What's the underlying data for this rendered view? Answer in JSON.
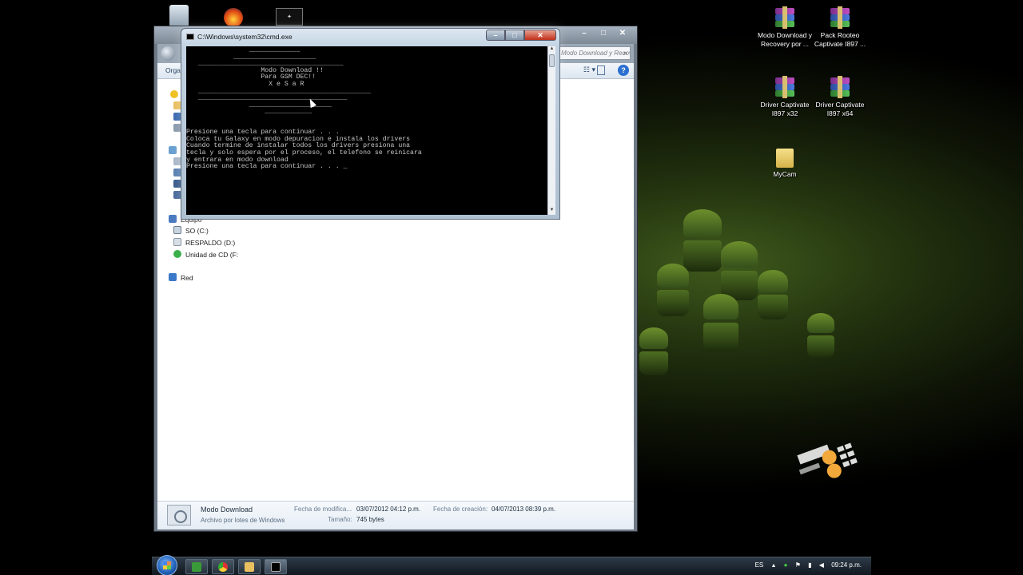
{
  "desktop": {
    "top_icons": [
      "recycle-bin-icon",
      "flame-app-icon",
      "synaptic-app-icon"
    ],
    "icons": [
      {
        "label": "Modo Download y Recovery por ...",
        "icon": "winrar-archive-icon"
      },
      {
        "label": "Pack Rooteo Captivate I897 ...",
        "icon": "winrar-archive-icon"
      },
      {
        "label": "Driver Captivate I897 x32",
        "icon": "winrar-archive-icon"
      },
      {
        "label": "Driver Captivate I897 x64",
        "icon": "winrar-archive-icon"
      },
      {
        "label": "MyCam",
        "icon": "folder-icon"
      }
    ],
    "wallpaper_color": "#3f5a1c"
  },
  "explorer": {
    "search_placeholder": "Modo Download y Recovery por ...",
    "organize_label": "Organizar",
    "nav": {
      "computer_label": "Equipo",
      "drives": [
        "SO (C:)",
        "RESPALDO (D:)",
        "Unidad de CD (F:"
      ],
      "network_label": "Red"
    },
    "details": {
      "name": "Modo Download",
      "type": "Archivo por lotes de Windows",
      "modified_label": "Fecha de modifica...",
      "modified_value": "03/07/2012 04:12 p.m.",
      "created_label": "Fecha de creación:",
      "created_value": "04/07/2013 08:39 p.m.",
      "size_label": "Tamaño:",
      "size_value": "745 bytes"
    }
  },
  "cmd": {
    "title": "C:\\Windows\\system32\\cmd.exe",
    "console_text": "                _____________\n            _____________________\n   _____________________________________\n                   Modo Download !!\n                   Para GSM DEC!!\n                     X e S a R\n   ____________________________________________\n   ______________________________________\n                _____________________\n                    ____________\n\n\nPresione una tecla para continuar . . .\nColoca tu Galaxy en modo depuracion e instala los drivers\nCuando termine de instalar todos los drivers presiona una\ntecla y solo espera por el proceso, el telefono se reinicara\ny entrara en modo download\nPresione una tecla para continuar . . . _"
  },
  "taskbar": {
    "language": "ES",
    "time": "09:24 p.m.",
    "pinned": [
      "camtasia-icon",
      "chrome-icon",
      "explorer-folder-icon",
      "cmd-icon"
    ]
  }
}
